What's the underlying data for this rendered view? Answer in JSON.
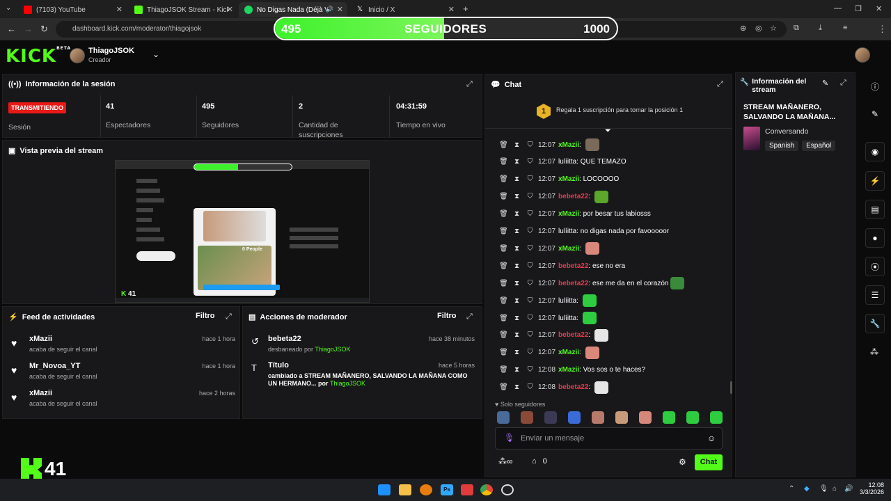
{
  "browser": {
    "tabs": [
      {
        "title": "(7103) YouTube",
        "color": "#ff0000"
      },
      {
        "title": "ThiagoJSOK Stream - Kick Dashb",
        "color": "#53fc18"
      },
      {
        "title": "No Digas Nada (Déjà Vu) - ",
        "color": "#1ed760"
      },
      {
        "title": "Inicio / X",
        "color": "#ffffff"
      }
    ],
    "url": "dashboard.kick.com/moderator/thiagojsok"
  },
  "followers_overlay": {
    "current": "495",
    "label": "SEGUIDORES",
    "goal": "1000",
    "progress_fraction": 0.495
  },
  "header": {
    "logo": "KICK",
    "logo_beta": "BETA",
    "username": "ThiagoJSOK",
    "role": "Creador"
  },
  "session": {
    "title": "Información de la sesión",
    "status": "TRANSMITIENDO",
    "status_label": "Sesión",
    "stats": [
      {
        "value": "41",
        "label": "Espectadores"
      },
      {
        "value": "495",
        "label": "Seguidores"
      },
      {
        "value": "2",
        "label": "Cantidad de suscripciones"
      },
      {
        "value": "04:31:59",
        "label": "Tiempo en vivo"
      }
    ]
  },
  "preview": {
    "title": "Vista previa del stream",
    "inner_people": "0 People"
  },
  "feed": {
    "title": "Feed de actividades",
    "filter": "Filtro",
    "items": [
      {
        "name": "xMazii",
        "action": "acaba de seguir el canal",
        "time": "hace 1 hora"
      },
      {
        "name": "Mr_Novoa_YT",
        "action": "acaba de seguir el canal",
        "time": "hace 1 hora"
      },
      {
        "name": "xMazii",
        "action": "acaba de seguir el canal",
        "time": "hace 2 horas"
      }
    ]
  },
  "mod_actions": {
    "title": "Acciones de moderador",
    "filter": "Filtro",
    "items": [
      {
        "name": "bebeta22",
        "detail": "desbaneado por",
        "by": "ThiagoJSOK",
        "time": "hace 38 minutos"
      },
      {
        "name": "Título",
        "detail": "cambiado a STREAM MAÑANERO, SALVANDO LA MAÑANA COMO UN HERMANO... por",
        "by": "ThiagoJSOK",
        "time": "hace 5 horas"
      }
    ]
  },
  "chat": {
    "title": "Chat",
    "pinned_rank": "1",
    "pinned": "Regala 1 suscripción para tomar la posición 1",
    "messages": [
      {
        "time": "12:07",
        "user": "xMazii",
        "color": "green",
        "text": "",
        "emote": "#7a6a5a"
      },
      {
        "time": "12:07",
        "user": "lulíitta",
        "color": "white",
        "text": "QUE TEMAZO",
        "emote": ""
      },
      {
        "time": "12:07",
        "user": "xMazii",
        "color": "green",
        "text": "LOCOOOO",
        "emote": ""
      },
      {
        "time": "12:07",
        "user": "bebeta22",
        "color": "red",
        "text": "",
        "emote": "#5aa52a"
      },
      {
        "time": "12:07",
        "user": "xMazii",
        "color": "green",
        "text": "por besar tus labiosss",
        "emote": ""
      },
      {
        "time": "12:07",
        "user": "lulíitta",
        "color": "white",
        "text": "no digas nada por favooooor",
        "emote": ""
      },
      {
        "time": "12:07",
        "user": "xMazii",
        "color": "green",
        "text": "",
        "emote": "#d9877a"
      },
      {
        "time": "12:07",
        "user": "bebeta22",
        "color": "red",
        "text": "ese no era",
        "emote": ""
      },
      {
        "time": "12:07",
        "user": "bebeta22",
        "color": "red",
        "text": "ese me da en el corazón",
        "emote": "#3b8a3b"
      },
      {
        "time": "12:07",
        "user": "lulíitta",
        "color": "white",
        "text": "",
        "emote": "#2ecc40"
      },
      {
        "time": "12:07",
        "user": "lulíitta",
        "color": "white",
        "text": "",
        "emote": "#2ecc40"
      },
      {
        "time": "12:07",
        "user": "bebeta22",
        "color": "red",
        "text": "",
        "emote": "#e6e6e6"
      },
      {
        "time": "12:07",
        "user": "xMazii",
        "color": "green",
        "text": "",
        "emote": "#d9877a"
      },
      {
        "time": "12:08",
        "user": "xMazii",
        "color": "green",
        "text": "Vos sos o te haces?",
        "emote": ""
      },
      {
        "time": "12:08",
        "user": "bebeta22",
        "color": "red",
        "text": "",
        "emote": "#e6e6e6"
      }
    ],
    "followers_only": "Solo seguidores",
    "input_placeholder": "Enviar un mensaje",
    "points": "0",
    "send": "Chat"
  },
  "stream_info": {
    "title": "Información del stream",
    "stream_title": "STREAM MAÑANERO, SALVANDO LA MAÑANA...",
    "category": "Conversando",
    "tags": [
      "Spanish",
      "Español"
    ]
  },
  "overlay_viewers": "41",
  "clock": {
    "time": "12:08",
    "date": "3/3/2026"
  },
  "colors": {
    "brand": "#53fc18",
    "live": "#e91916",
    "panel": "#18181b"
  }
}
